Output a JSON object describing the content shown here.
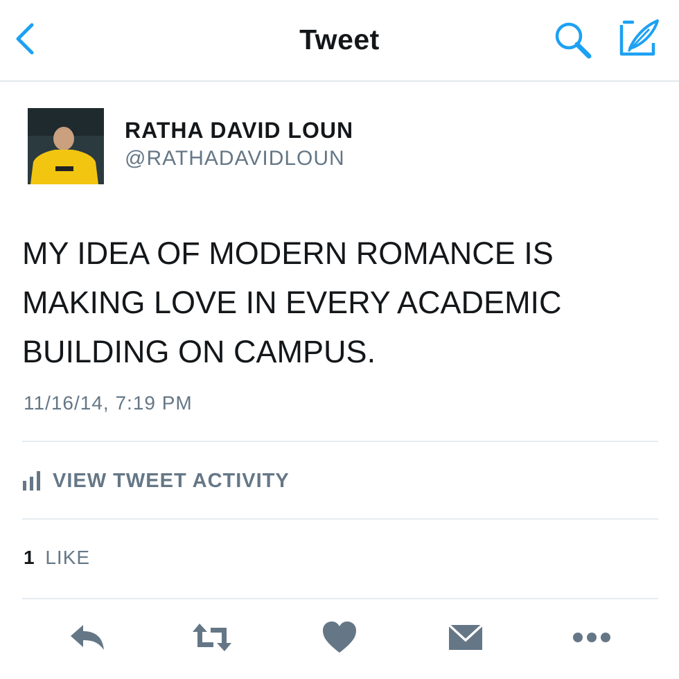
{
  "header": {
    "title": "Tweet",
    "icons": [
      "back-chevron-icon",
      "search-icon",
      "compose-icon"
    ],
    "accent_color": "#1da1f2"
  },
  "tweet": {
    "author_name": "RATHA DAVID LOUN",
    "author_handle": "@RATHADAVIDLOUN",
    "text": "MY IDEA OF MODERN ROMANCE IS MAKING LOVE IN EVERY ACADEMIC BUILDING ON CAMPUS.",
    "timestamp": "11/16/14, 7:19 PM",
    "activity_label": "VIEW TWEET ACTIVITY",
    "likes_count": "1",
    "likes_label": "LIKE"
  },
  "actions": {
    "icons": [
      "reply-icon",
      "retweet-icon",
      "like-heart-icon",
      "direct-message-icon",
      "more-icon"
    ],
    "icon_color": "#657786"
  }
}
